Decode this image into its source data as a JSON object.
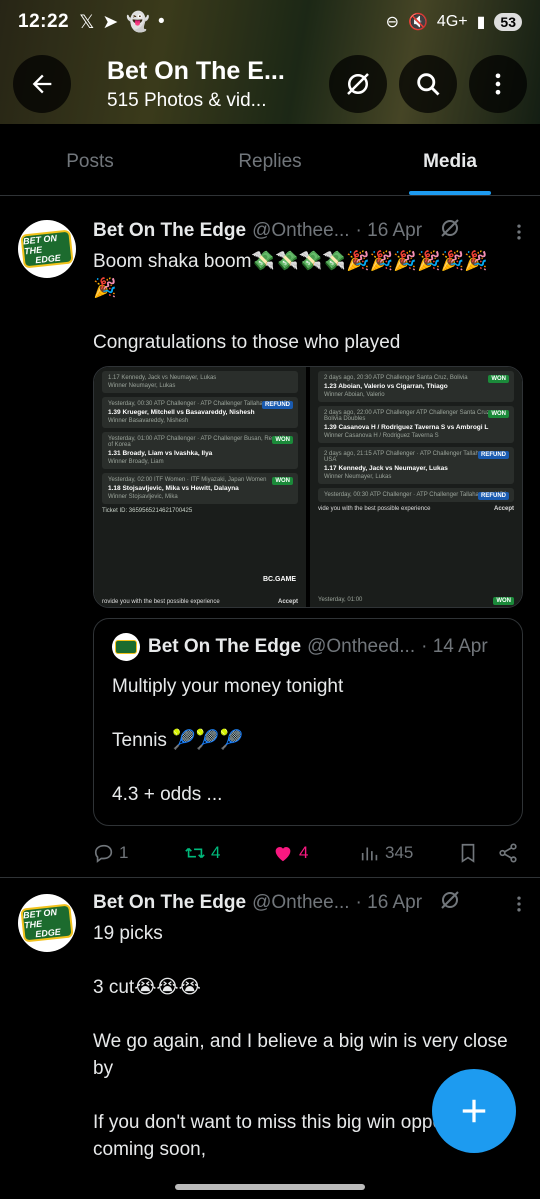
{
  "status_bar": {
    "time": "12:22",
    "network": "4G+",
    "battery": "53"
  },
  "header": {
    "title": "Bet On The E...",
    "subtitle": "515 Photos & vid..."
  },
  "tabs": [
    {
      "label": "Posts"
    },
    {
      "label": "Replies"
    },
    {
      "label": "Media"
    }
  ],
  "active_tab": "Media",
  "tweets": [
    {
      "name": "Bet On The Edge",
      "handle": "@Onthee...",
      "date": "· 16 Apr",
      "text": "Boom shaka boom💸💸💸💸🎉🎉🎉🎉🎉🎉\n🎉\n\nCongratulations to those who played",
      "media": {
        "left": {
          "cards": [
            {
              "l1": "1.17  Kennedy, Jack vs Neumayer, Lukas",
              "l2": "Winner Neumayer, Lukas",
              "l3": "",
              "badge": ""
            },
            {
              "l1": "Yesterday, 00:30  ATP Challenger · ATP Challenger Tallahassee, USA",
              "l2": "1.39  Krueger, Mitchell vs Basavareddy, Nishesh",
              "l3": "Winner Basavareddy, Nishesh",
              "badge": "REFUND"
            },
            {
              "l1": "Yesterday, 01:00  ATP Challenger · ATP Challenger Busan, Republic of Korea",
              "l2": "1.31  Broady, Liam vs Ivashka, Ilya",
              "l3": "Winner Broady, Liam",
              "badge": "WON"
            },
            {
              "l1": "Yesterday, 02:00  ITF Women · ITF Miyazaki, Japan Women",
              "l2": "1.18  Stojsavljevic, Mika vs Hewitt, Dalayna",
              "l3": "Winner Stojsavljevic, Mika",
              "badge": "WON"
            }
          ],
          "footer": "Ticket ID: 3659565214621700425",
          "brand": "BC.GAME",
          "cookie": "rovide you with the best possible experience",
          "accept": "Accept"
        },
        "right": {
          "cards": [
            {
              "l1": "2 days ago, 20:30  ATP Challenger Santa Cruz, Bolivia",
              "l2": "1.23  Aboian, Valerio vs Cigarran, Thiago",
              "l3": "Winner Aboian, Valerio",
              "badge": "WON"
            },
            {
              "l1": "2 days ago, 22:00  ATP Challenger ATP Challenger Santa Cruz, Bolivia Doubles",
              "l2": "1.39  Casanova H / Rodriguez Taverna S vs Ambrogi L",
              "l3": "Winner Casanova H / Rodriguez Taverna S",
              "badge": "WON"
            },
            {
              "l1": "2 days ago, 21:15  ATP Challenger · ATP Challenger Tallahassee, USA",
              "l2": "1.17  Kennedy, Jack vs Neumayer, Lukas",
              "l3": "Winner Neumayer, Lukas",
              "badge": "REFUND"
            },
            {
              "l1": "Yesterday, 00:30  ATP Challenger · ATP Challenger Tallahassee, USA",
              "l2": "",
              "l3": "",
              "badge": "REFUND"
            }
          ],
          "cookie": "vide you with the best possible experience",
          "accept": "Accept",
          "footer": "Yesterday, 01:00",
          "bottom_badge": "WON"
        }
      },
      "quote": {
        "name": "Bet On The Edge",
        "handle": "@Ontheed...",
        "date": "· 14 Apr",
        "text": "Multiply your money tonight\n\nTennis 🎾🎾🎾\n\n4.3 + odds ..."
      },
      "stats": {
        "replies": "1",
        "reposts": "4",
        "likes": "4",
        "views": "345"
      }
    },
    {
      "name": "Bet On The Edge",
      "handle": "@Onthee...",
      "date": "· 16 Apr",
      "text": "19 picks\n\n3 cut😭😭😭\n\nWe go again, and I believe a big win is very close by\n\nIf you don't want to miss this big win opportunity coming soon,"
    }
  ],
  "avatar_logo": {
    "line1": "BET ON THE",
    "line2": "EDGE"
  },
  "colors": {
    "accent": "#1d9bf0",
    "repost": "#00ba7c",
    "like": "#f91880",
    "muted": "#71767b",
    "won": "#1b8a3a",
    "refund": "#1a5bb0"
  },
  "icons": [
    "back-arrow-icon",
    "grok-icon",
    "search-icon",
    "more-vertical-icon",
    "reply-icon",
    "repost-icon",
    "heart-icon",
    "views-icon",
    "bookmark-icon",
    "share-icon",
    "plus-icon"
  ]
}
